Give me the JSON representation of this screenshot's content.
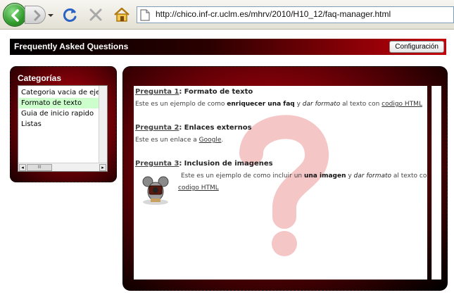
{
  "browser": {
    "url": "http://chico.inf-cr.uclm.es/mhrv/2010/H10_12/faq-manager.html"
  },
  "header": {
    "title": "Frequently Asked Questions",
    "config_label": "Configuración"
  },
  "categories": {
    "title": "Categorías",
    "items": [
      {
        "label": "Categoria vacia de ejer"
      },
      {
        "label": "Formato de texto"
      },
      {
        "label": "Guia de inicio rapido"
      },
      {
        "label": "Listas"
      }
    ],
    "selected_index": 1,
    "scroll_thumb_grip": "III"
  },
  "faqs": [
    {
      "question_label": "Pregunta 1",
      "separator": ":",
      "title": "Formato de texto",
      "answer": {
        "t1": "Este es un ejemplo de como ",
        "b1": "enriquecer una faq",
        "t2": " y ",
        "i1": "dar formato",
        "t3": " al texto con ",
        "link": "codigo HTML"
      }
    },
    {
      "question_label": "Pregunta 2",
      "separator": ":",
      "title": "Enlaces externos",
      "answer": {
        "t1": "Este es un enlace a ",
        "link": "Google",
        "t2": "."
      }
    },
    {
      "question_label": "Pregunta 3",
      "separator": ":",
      "title": "Inclusion de imagenes",
      "answer": {
        "t1": "Este es un ejemplo de como incluir un ",
        "b1": "una imagen",
        "t2": " y ",
        "i1": "dar formato",
        "t3": " al texto con",
        "link": "codigo HTML"
      }
    }
  ],
  "colors": {
    "header_red": "#c4000a",
    "selected_green": "#ccffcc",
    "panel_dark": "#1a0000"
  }
}
